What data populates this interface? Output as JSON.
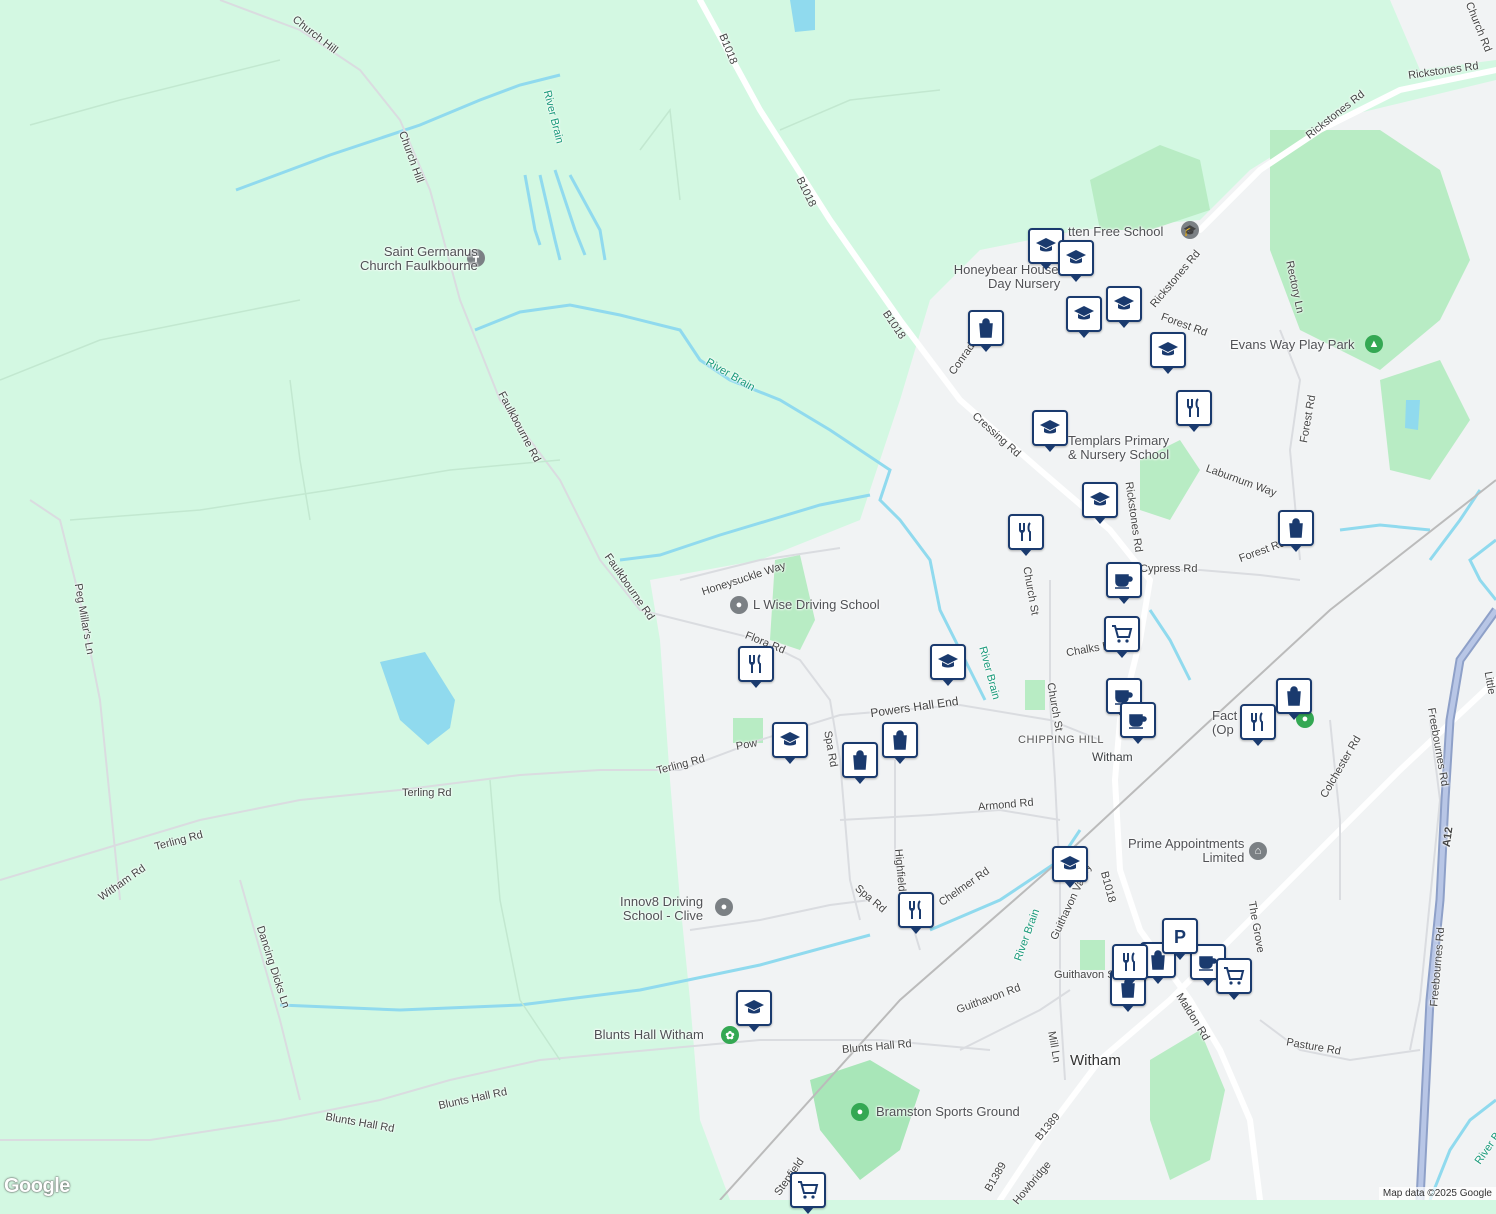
{
  "map": {
    "attribution": "Map data ©2025 Google",
    "logo": "Google",
    "colors": {
      "land": "#d3f8e2",
      "urban": "#f1f3f4",
      "water": "#90daee",
      "park": "#a8e6b8",
      "road": "#dadce0",
      "marker": "#1a3a6e"
    }
  },
  "roads": [
    "Church Hill",
    "Church Hill",
    "Faulkbourne Rd",
    "Faulkbourne Rd",
    "Peg Millar's Ln",
    "Terling Rd",
    "Terling Rd",
    "Terling Rd",
    "Witham Rd",
    "Dancing Dicks Ln",
    "Blunts Hall Rd",
    "Blunts Hall Rd",
    "Blunts Hall Rd",
    "B1018",
    "B1018",
    "B1018",
    "Cressing Rd",
    "Rickstones Rd",
    "Rickstones Rd",
    "Rickstones Rd",
    "Church Rd",
    "Rectory Ln",
    "Forest Rd",
    "Forest Rd",
    "Forest Rd",
    "Laburnum Way",
    "Cypress Rd",
    "Church St",
    "Church St",
    "Chalks Rd",
    "Powers Hall End",
    "Flora Rd",
    "Honeysuckle Way",
    "Spa Rd",
    "Spa Rd",
    "Armond Rd",
    "Chelmer Rd",
    "Guithavon Valley",
    "Guithavon Rd",
    "Guithavon St",
    "Mill Ln",
    "B1389",
    "B1389",
    "Maldon Rd",
    "Pasture Rd",
    "The Grove",
    "Colchester Rd",
    "Freebournes Rd",
    "Freebournes Rd",
    "A12",
    "Conrad",
    "Highfields",
    "Pow",
    "B1018",
    "Howbridge",
    "Stepfield",
    "Little",
    "Rickstones Rd"
  ],
  "water_labels": [
    "River Brain",
    "River Brain",
    "River Brain",
    "River Brain",
    "River Brain"
  ],
  "places": [
    {
      "name": "Saint Germanus Church Faulkbourne",
      "line1": "Saint Germanus",
      "line2": "Church Faulkbourne"
    },
    {
      "name": "L Wise Driving School"
    },
    {
      "name": "Innov8 Driving School - Clive",
      "line1": "Innov8 Driving",
      "line2": "School - Clive"
    },
    {
      "name": "Blunts Hall Witham"
    },
    {
      "name": "Bramston Sports Ground"
    },
    {
      "name": "Prime Appointments Limited",
      "line1": "Prime Appointments",
      "line2": "Limited"
    },
    {
      "name": "Evans Way Play Park"
    },
    {
      "name": "Templars Primary & Nursery School",
      "line1": "Templars Primary",
      "line2": "& Nursery School"
    },
    {
      "name": "Honeybear House Day Nursery",
      "line1": "Honeybear House",
      "line2": "Day Nursery"
    },
    {
      "name": "Rivenhall Free School",
      "line1": "tten Free School"
    },
    {
      "name": "Factory Outlet",
      "line1": "Fact",
      "line2": "(Op"
    }
  ],
  "districts": [
    "CHIPPING HILL",
    "Witham",
    "Witham"
  ],
  "marker_types": {
    "school": "school-icon",
    "shop": "shopping-bag-icon",
    "food": "restaurant-icon",
    "cafe": "cafe-icon",
    "grocery": "shopping-cart-icon",
    "parking": "parking-icon"
  }
}
